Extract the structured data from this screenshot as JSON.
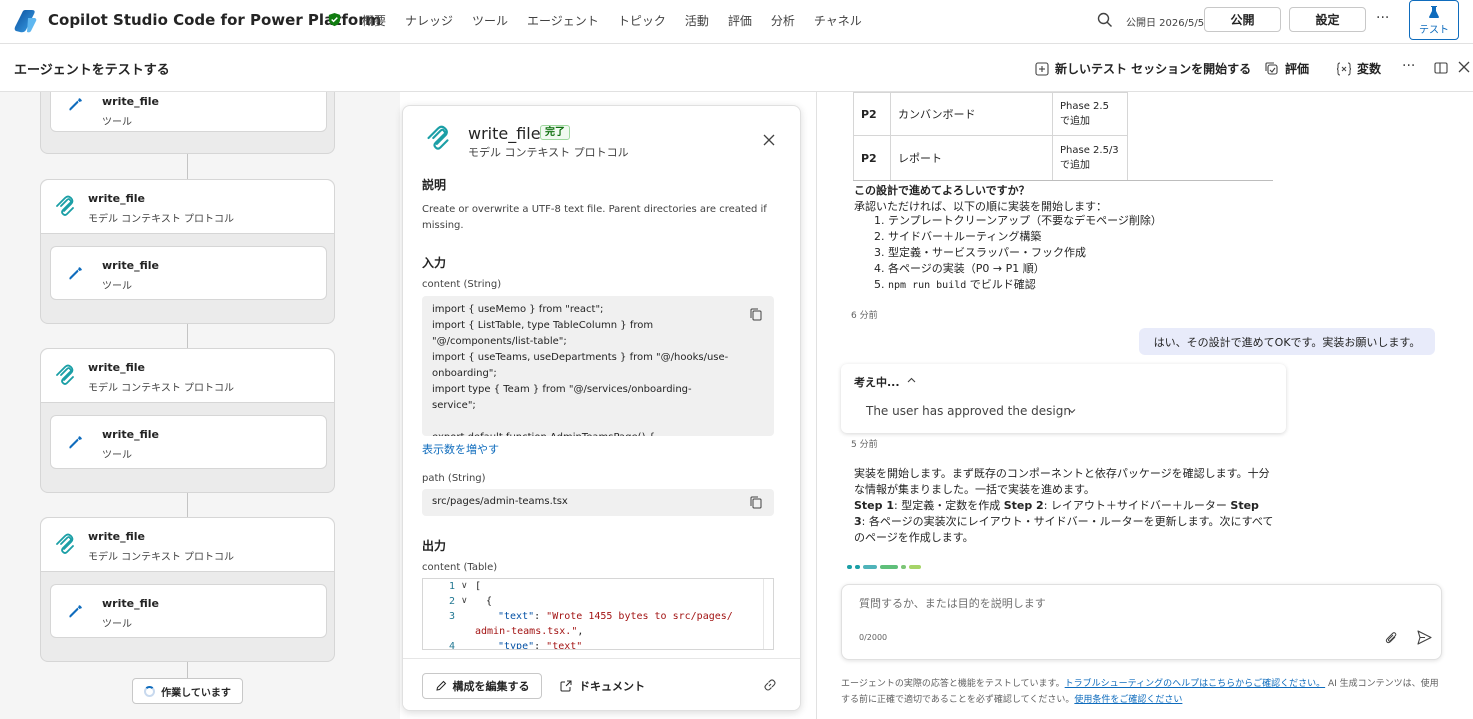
{
  "header": {
    "app_title": "Copilot Studio Code for Power Platform",
    "nav": [
      "概要",
      "ナレッジ",
      "ツール",
      "エージェント",
      "トピック",
      "活動",
      "評価",
      "分析",
      "チャネル"
    ],
    "publish_date": "公開日 2026/5/5",
    "publish_label": "公開",
    "settings_label": "設定",
    "more_label": "···",
    "test_label": "テスト"
  },
  "subheader": {
    "title": "エージェントをテストする",
    "new_session": "新しいテスト セッションを開始する",
    "evaluate": "評価",
    "variables": "変数",
    "more_label": "···"
  },
  "flow": {
    "tool_title": "write_file",
    "tool_subtitle": "ツール",
    "mcp_title": "write_file",
    "mcp_subtitle": "モデル コンテキスト プロトコル",
    "working_label": "作業しています"
  },
  "detail": {
    "title": "write_file",
    "badge": "完了",
    "subtitle": "モデル コンテキスト プロトコル",
    "desc_heading": "説明",
    "description": "Create or overwrite a UTF-8 text file. Parent directories are created if missing.",
    "input_heading": "入力",
    "content_label": "content (String)",
    "content_value": "import { useMemo } from \"react\";\nimport { ListTable, type TableColumn } from \"@/components/list-table\";\nimport { useTeams, useDepartments } from \"@/hooks/use-onboarding\";\nimport type { Team } from \"@/services/onboarding-service\";\n\nexport default function AdminTeamsPage() {\n  const teams = useTeams();",
    "show_more": "表示数を増やす",
    "path_label": "path (String)",
    "path_value": "src/pages/admin-teams.tsx",
    "output_heading": "出力",
    "output_label": "content (Table)",
    "output_lines": {
      "l1": "[",
      "l2": "{",
      "l3_key": "\"text\"",
      "l3_sep": ": ",
      "l3_val": "\"Wrote 1455 bytes to src/pages/",
      "l3_cont": "admin-teams.tsx.\"",
      "l3_comma": ",",
      "l4_key": "\"type\"",
      "l4_val": "\"text\""
    },
    "edit_label": "構成を編集する",
    "doc_label": "ドキュメント"
  },
  "chat": {
    "table_rows": [
      {
        "priority": "P2",
        "feature": "カンバンボード",
        "phase": "Phase 2.5\nで追加"
      },
      {
        "priority": "P2",
        "feature": "レポート",
        "phase": "Phase 2.5/3\nで追加"
      }
    ],
    "question": "この設計で進めてよろしいですか？",
    "intro": "承認いただければ、以下の順に実装を開始します：",
    "steps": {
      "s1": "テンプレートクリーンアップ（不要なデモページ削除）",
      "s2": "サイドバー＋ルーティング構築",
      "s3": "型定義・サービスラッパー・フック作成",
      "s4": "各ページの実装（P0 → P1 順）",
      "s5_code": "npm run build",
      "s5_text": " でビルド確認"
    },
    "time1": "6 分前",
    "user_message": "はい、その設計で進めてOKです。実装お願いします。",
    "thinking_label": "考え中...",
    "thinking_summary": "The user has approved the design",
    "time2": "5 分前",
    "response": {
      "p1": "実装を開始します。まず既存のコンポーネントと依存パッケージを確認します。十分な情報が集まりました。一括で実装を進めます。",
      "step1_label": "Step 1",
      "step1_text": ": 型定義・定数を作成 ",
      "step2_label": "Step 2",
      "step2_text": ": レイアウト＋サイドバー＋ルーター ",
      "step3_label": "Step 3",
      "step3_text": ": 各ページの実装次にレイアウト・サイドバー・ルーターを更新します。次にすべてのページを作成します。"
    },
    "input_placeholder": "質問するか、または目的を説明します",
    "char_count": "0/2000",
    "disclaimer_text1": "エージェントの実際の応答と機能をテストしています。",
    "disclaimer_link1": "トラブルシューティングのヘルプはこちらからご確認ください。",
    "disclaimer_text2": "AI 生成コンテンツは、使用する前に正確で適切であることを必ず確認してください。",
    "disclaimer_link2": "使用条件をご確認ください"
  },
  "colors": {
    "brand": "#0f6cbd",
    "mcp_icon": "#1b9fa6",
    "success": "#0e700e",
    "user_bubble": "#e8ebfa"
  },
  "icons": [
    "copilot-logo-icon",
    "verified-shield-icon",
    "search-icon",
    "test-beaker-icon",
    "new-session-icon",
    "evaluate-icon",
    "variables-icon",
    "panel-icon",
    "close-icon",
    "mcp-icon",
    "wrench-icon",
    "copy-icon",
    "pencil-icon",
    "external-link-icon",
    "link-icon",
    "chevron-up-icon",
    "chevron-down-icon",
    "attach-icon",
    "send-icon"
  ]
}
